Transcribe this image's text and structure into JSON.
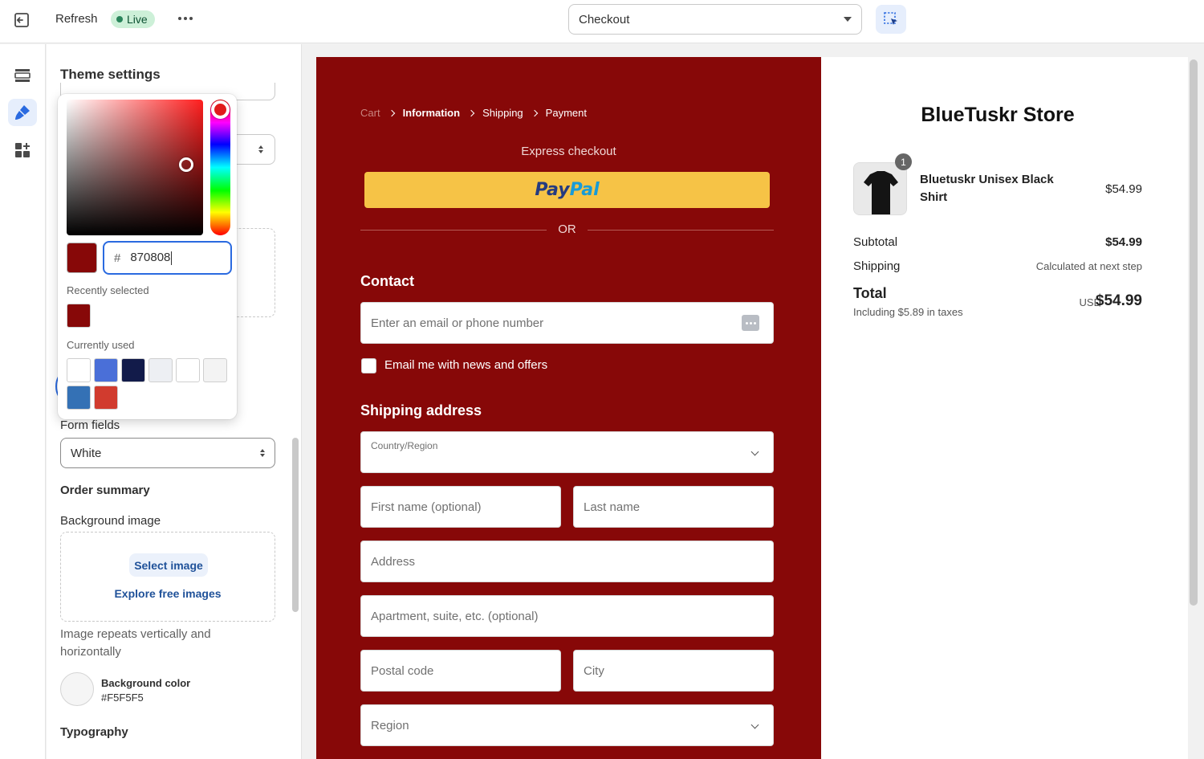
{
  "topbar": {
    "refresh_label": "Refresh",
    "live_label": "Live",
    "template_select": "Checkout"
  },
  "colors": {
    "brand_bg": "#870808",
    "paypal_yellow": "#F6C346",
    "link_blue": "#1F5199",
    "accent_blue": "#2A6AE0"
  },
  "icons": {
    "exit": "exit-icon",
    "more": "more-horizontal-icon",
    "inspect": "select-inspector-icon",
    "sections": "sections-icon",
    "theme": "paintbrush-icon",
    "apps": "apps-icon",
    "phone_autofill": "autofill-dots-icon"
  },
  "settings": {
    "title": "Theme settings",
    "form_fields_label": "Form fields",
    "form_fields_value": "White",
    "order_summary_heading": "Order summary",
    "background_image_label": "Background image",
    "select_image_button": "Select image",
    "explore_images_link": "Explore free images",
    "image_help": "Image repeats vertically and horizontally",
    "bg_color_label": "Background color",
    "bg_color_value": "#F5F5F5",
    "typography_heading": "Typography"
  },
  "color_picker": {
    "hash": "#",
    "hex_value": "870808",
    "current_color": "#870808",
    "recently_selected_label": "Recently selected",
    "recently_selected": [
      "#870808"
    ],
    "currently_used_label": "Currently used",
    "currently_used": [
      "#FFFFFF",
      "#4A6FD8",
      "#121B4A",
      "#EDEFF3",
      "#FFFFFF",
      "#F3F3F3",
      "#3471B5",
      "#D13B2E"
    ]
  },
  "checkout": {
    "breadcrumb": [
      "Cart",
      "Information",
      "Shipping",
      "Payment"
    ],
    "express_label": "Express checkout",
    "paypal_part1": "Pay",
    "paypal_part2": "Pal",
    "or_label": "OR",
    "contact_heading": "Contact",
    "email_placeholder": "Enter an email or phone number",
    "newsletter_label": "Email me with news and offers",
    "shipping_heading": "Shipping address",
    "country_label": "Country/Region",
    "first_name_placeholder": "First name (optional)",
    "last_name_placeholder": "Last name",
    "address_placeholder": "Address",
    "apartment_placeholder": "Apartment, suite, etc. (optional)",
    "postal_placeholder": "Postal code",
    "city_placeholder": "City",
    "region_placeholder": "Region"
  },
  "summary": {
    "store_name": "BlueTuskr Store",
    "product_name": "Bluetuskr Unisex Black Shirt",
    "product_qty": "1",
    "product_price": "$54.99",
    "subtotal_label": "Subtotal",
    "subtotal_value": "$54.99",
    "shipping_label": "Shipping",
    "shipping_value": "Calculated at next step",
    "total_label": "Total",
    "taxes_note": "Including $5.89 in taxes",
    "currency": "USD",
    "total_value": "$54.99"
  }
}
